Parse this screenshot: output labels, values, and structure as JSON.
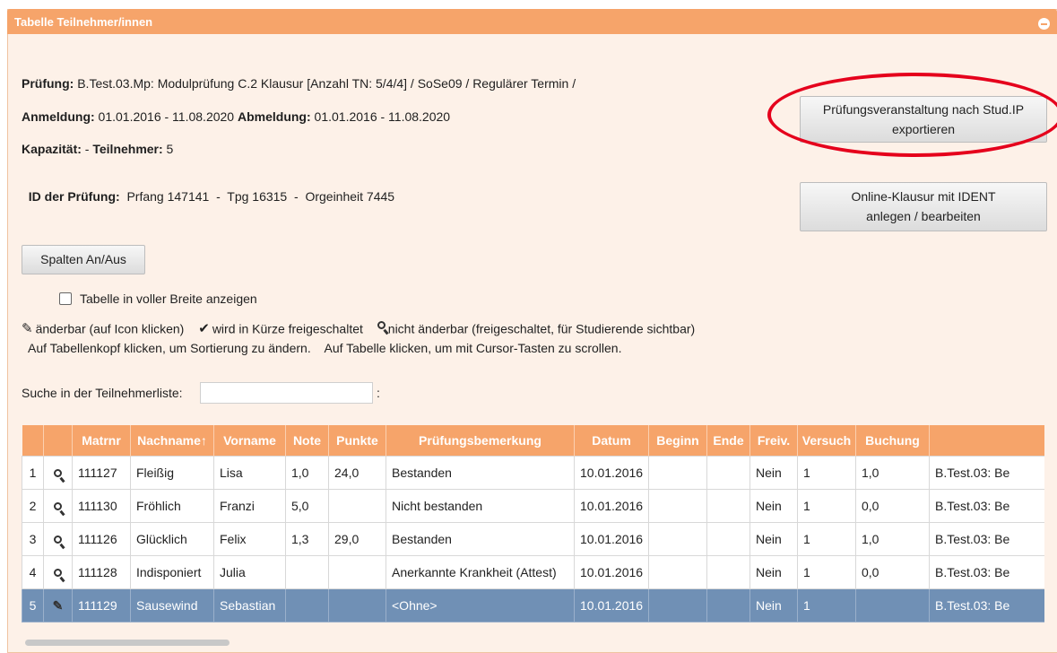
{
  "panel": {
    "title": "Tabelle Teilnehmer/innen"
  },
  "info": {
    "pruefung_label": "Prüfung:",
    "pruefung_value": " B.Test.03.Mp: Modulprüfung C.2 Klausur [Anzahl TN: 5/4/4] / SoSe09 / Regulärer Termin /",
    "anmeldung_label": "Anmeldung:",
    "anmeldung_value": " 01.01.2016 - 11.08.2020 ",
    "abmeldung_label": "Abmeldung:",
    "abmeldung_value": " 01.01.2016 - 11.08.2020",
    "kapazitaet_label": "Kapazität:",
    "kapazitaet_value": " - ",
    "teilnehmer_label": "Teilnehmer:",
    "teilnehmer_value": " 5",
    "id_label": "ID der Prüfung:",
    "id_value": "  Prfang 147141  -  Tpg 16315  -  Orgeinheit 7445"
  },
  "buttons": {
    "export_line1": "Prüfungsveranstaltung nach Stud.IP",
    "export_line2": "exportieren",
    "online_line1": "Online-Klausur mit IDENT",
    "online_line2": "anlegen / bearbeiten",
    "spalten": "Spalten An/Aus"
  },
  "options": {
    "full_width_label": "Tabelle in voller Breite anzeigen"
  },
  "legend": {
    "editable": "änderbar (auf Icon klicken)",
    "soon": "wird in Kürze freigeschaltet",
    "locked": "nicht änderbar (freigeschaltet, für Studierende sichtbar)",
    "hint": "Auf Tabellenkopf klicken, um Sortierung zu ändern.    Auf Tabelle klicken, um mit Cursor-Tasten zu scrollen."
  },
  "search": {
    "label": "Suche in der Teilnehmerliste:",
    "value": "",
    "colon": ":"
  },
  "table": {
    "columns": [
      "",
      "",
      "Matrnr",
      "Nachname↑",
      "Vorname",
      "Note",
      "Punkte",
      "Prüfungsbemerkung",
      "Datum",
      "Beginn",
      "Ende",
      "Freiv.",
      "Versuch",
      "Buchung",
      ""
    ],
    "rows": [
      {
        "no": "1",
        "icon": "magnifier-icon",
        "matrnr": "111127",
        "nachname": "Fleißig",
        "vorname": "Lisa",
        "note": "1,0",
        "punkte": "24,0",
        "bemerkung": "Bestanden",
        "datum": "10.01.2016",
        "beginn": "",
        "ende": "",
        "freiv": "Nein",
        "versuch": "1",
        "buchung": "1,0",
        "modul": "B.Test.03: Be"
      },
      {
        "no": "2",
        "icon": "magnifier-icon",
        "matrnr": "111130",
        "nachname": "Fröhlich",
        "vorname": "Franzi",
        "note": "5,0",
        "punkte": "",
        "bemerkung": "Nicht bestanden",
        "datum": "10.01.2016",
        "beginn": "",
        "ende": "",
        "freiv": "Nein",
        "versuch": "1",
        "buchung": "0,0",
        "modul": "B.Test.03: Be"
      },
      {
        "no": "3",
        "icon": "magnifier-icon",
        "matrnr": "111126",
        "nachname": "Glücklich",
        "vorname": "Felix",
        "note": "1,3",
        "punkte": "29,0",
        "bemerkung": "Bestanden",
        "datum": "10.01.2016",
        "beginn": "",
        "ende": "",
        "freiv": "Nein",
        "versuch": "1",
        "buchung": "1,0",
        "modul": "B.Test.03: Be"
      },
      {
        "no": "4",
        "icon": "magnifier-icon",
        "matrnr": "111128",
        "nachname": "Indisponiert",
        "vorname": "Julia",
        "note": "",
        "punkte": "",
        "bemerkung": "Anerkannte Krankheit (Attest)",
        "datum": "10.01.2016",
        "beginn": "",
        "ende": "",
        "freiv": "Nein",
        "versuch": "1",
        "buchung": "0,0",
        "modul": "B.Test.03: Be"
      },
      {
        "no": "5",
        "icon": "pencil-icon",
        "matrnr": "111129",
        "nachname": "Sausewind",
        "vorname": "Sebastian",
        "note": "",
        "punkte": "",
        "bemerkung": "<Ohne>",
        "datum": "10.01.2016",
        "beginn": "",
        "ende": "",
        "freiv": "Nein",
        "versuch": "1",
        "buchung": "",
        "modul": "B.Test.03: Be"
      }
    ]
  },
  "colors": {
    "header": "#f6a46a",
    "selected_row": "#7090b5",
    "annotation": "#e5001c"
  }
}
